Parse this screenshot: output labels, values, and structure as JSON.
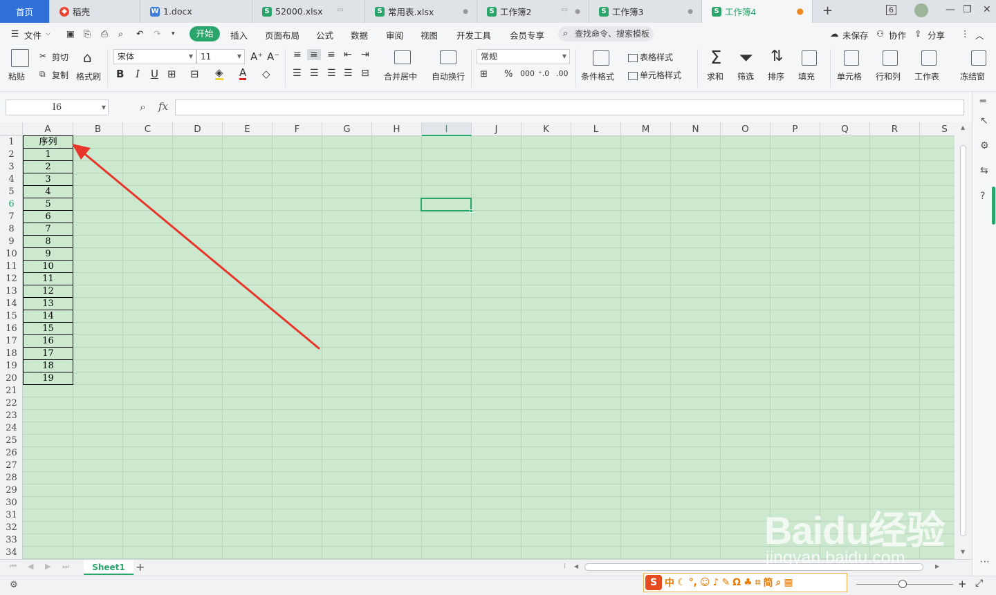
{
  "tabs": {
    "home": "首页",
    "items": [
      {
        "label": "稻壳",
        "type": "d"
      },
      {
        "label": "1.docx",
        "type": "w"
      },
      {
        "label": "52000.xlsx",
        "type": "s"
      },
      {
        "label": "常用表.xlsx",
        "type": "s"
      },
      {
        "label": "工作簿2",
        "type": "s"
      },
      {
        "label": "工作簿3",
        "type": "s"
      },
      {
        "label": "工作簿4",
        "type": "s"
      }
    ],
    "new_tab": "+",
    "window_count": "6"
  },
  "menu": {
    "file": "文件",
    "start": "开始",
    "items": [
      "插入",
      "页面布局",
      "公式",
      "数据",
      "审阅",
      "视图",
      "开发工具",
      "会员专享"
    ],
    "search": "查找命令、搜索模板",
    "unsaved": "未保存",
    "collab": "协作",
    "share": "分享"
  },
  "ribbon": {
    "paste": "粘贴",
    "cut": "剪切",
    "copy": "复制",
    "format_painter": "格式刷",
    "font_name": "宋体",
    "font_size": "11",
    "merge_center": "合并居中",
    "wrap_text": "自动换行",
    "number_format": "常规",
    "cond_format": "条件格式",
    "table_style": "表格样式",
    "cell_style": "单元格样式",
    "sum": "求和",
    "filter": "筛选",
    "sort": "排序",
    "fill": "填充",
    "cell": "单元格",
    "row_col": "行和列",
    "worksheet": "工作表",
    "freeze": "冻结窗"
  },
  "formula": {
    "name_box": "I6",
    "fx": "fx",
    "value": ""
  },
  "sheet": {
    "columns": [
      "A",
      "B",
      "C",
      "D",
      "E",
      "F",
      "G",
      "H",
      "I",
      "J",
      "K",
      "L",
      "M",
      "N",
      "O",
      "P",
      "Q",
      "R",
      "S"
    ],
    "selected_column": "I",
    "selected_row": "6",
    "rows": [
      "1",
      "2",
      "3",
      "4",
      "5",
      "6",
      "7",
      "8",
      "9",
      "10",
      "11",
      "12",
      "13",
      "14",
      "15",
      "16",
      "17",
      "18",
      "19",
      "20",
      "21",
      "22",
      "23",
      "24",
      "25",
      "26",
      "27",
      "28",
      "29",
      "30",
      "31",
      "32",
      "33",
      "34"
    ],
    "colA_values": [
      "序列",
      "1",
      "2",
      "3",
      "4",
      "5",
      "6",
      "7",
      "8",
      "9",
      "10",
      "11",
      "12",
      "13",
      "14",
      "15",
      "16",
      "17",
      "18",
      "19"
    ],
    "active_cell": "I6"
  },
  "sheettabs": {
    "tabs": [
      "Sheet1"
    ],
    "add": "+"
  },
  "ime": {
    "items": [
      "中",
      "简"
    ]
  },
  "watermark": {
    "main": "Baidu经验",
    "sub": "jingyan.baidu.com"
  },
  "colors": {
    "accent": "#2aa56b",
    "grid_bg": "#cce8cf",
    "arrow": "#e8352a",
    "home_tab": "#2f6fd8"
  }
}
